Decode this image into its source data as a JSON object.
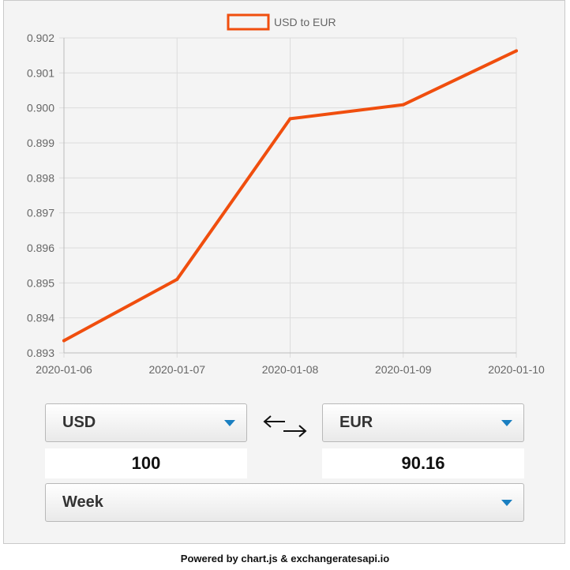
{
  "chart_data": {
    "type": "line",
    "x": [
      "2020-01-06",
      "2020-01-07",
      "2020-01-08",
      "2020-01-09",
      "2020-01-10"
    ],
    "series": [
      {
        "name": "USD to EUR",
        "values": [
          0.89335,
          0.8951,
          0.89969,
          0.90009,
          0.90163
        ]
      }
    ],
    "y_ticks": [
      "0.902",
      "0.901",
      "0.900",
      "0.899",
      "0.898",
      "0.897",
      "0.896",
      "0.895",
      "0.894",
      "0.893"
    ],
    "ylim": [
      0.893,
      0.902
    ],
    "grid": true,
    "legend_position": "top-center",
    "line_color": "#f04e0e"
  },
  "converter": {
    "from_currency": "USD",
    "to_currency": "EUR",
    "from_amount": "100",
    "to_amount": "90.16",
    "period": "Week",
    "swap_icon": "swap-arrows-icon",
    "dropdown_icon": "caret-down-icon",
    "accent_color": "#1a7fc1"
  },
  "footer": {
    "text": "Powered by chart.js & exchangeratesapi.io"
  }
}
